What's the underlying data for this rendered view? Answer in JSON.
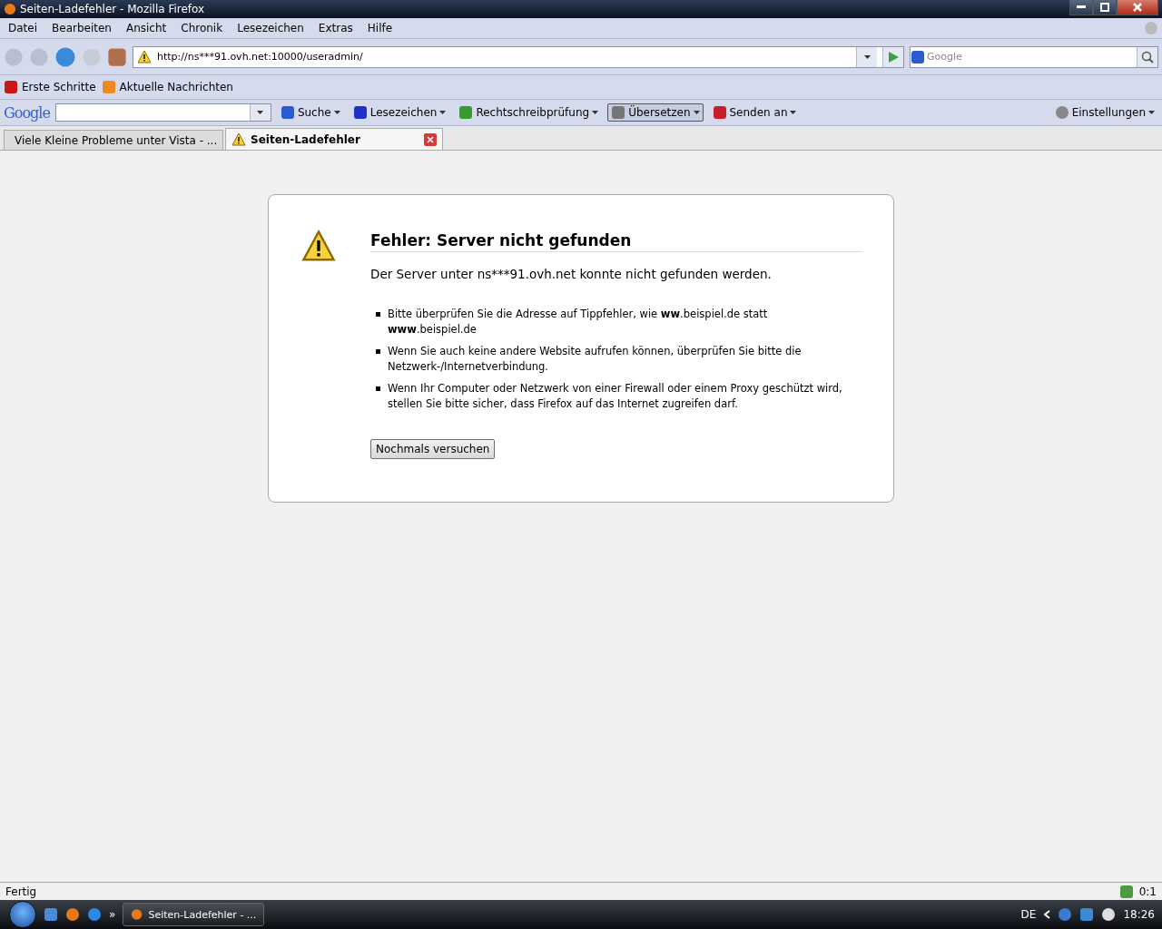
{
  "window": {
    "title": "Seiten-Ladefehler - Mozilla Firefox"
  },
  "menu": [
    "Datei",
    "Bearbeiten",
    "Ansicht",
    "Chronik",
    "Lesezeichen",
    "Extras",
    "Hilfe"
  ],
  "navigation": {
    "url": "http://ns***91.ovh.net:10000/useradmin/",
    "search_placeholder": "Google"
  },
  "bookmarks": [
    "Erste Schritte",
    "Aktuelle Nachrichten"
  ],
  "google_toolbar": {
    "logo": "Google",
    "buttons": [
      {
        "label": "Suche",
        "dropdown": true,
        "selected": false
      },
      {
        "label": "Lesezeichen",
        "dropdown": true,
        "selected": false
      },
      {
        "label": "Rechtschreibprüfung",
        "dropdown": true,
        "selected": false
      },
      {
        "label": "Übersetzen",
        "dropdown": true,
        "selected": true
      },
      {
        "label": "Senden an",
        "dropdown": true,
        "selected": false
      }
    ],
    "settings": "Einstellungen"
  },
  "tabs": [
    {
      "label": "Viele Kleine Probleme unter Vista - ...",
      "selected": false
    },
    {
      "label": "Seiten-Ladefehler",
      "selected": true
    }
  ],
  "error": {
    "title": "Fehler: Server nicht gefunden",
    "message": "Der Server unter ns***91.ovh.net konnte nicht gefunden werden.",
    "bullets": [
      "Bitte überprüfen Sie die Adresse auf Tippfehler, wie **ww**.beispiel.de statt **www**.beispiel.de",
      "Wenn Sie auch keine andere Website aufrufen können, überprüfen Sie bitte die Netzwerk-/Internetverbindung.",
      "Wenn Ihr Computer oder Netzwerk von einer Firewall oder einem Proxy geschützt wird, stellen Sie bitte sicher, dass Firefox auf das Internet zugreifen darf."
    ],
    "button": "Nochmals versuchen"
  },
  "status_bar": {
    "text": "Fertig",
    "counter": "0:1"
  },
  "taskbar": {
    "task": "Seiten-Ladefehler - ...",
    "language": "DE",
    "clock": "18:26",
    "overflow": "»"
  }
}
